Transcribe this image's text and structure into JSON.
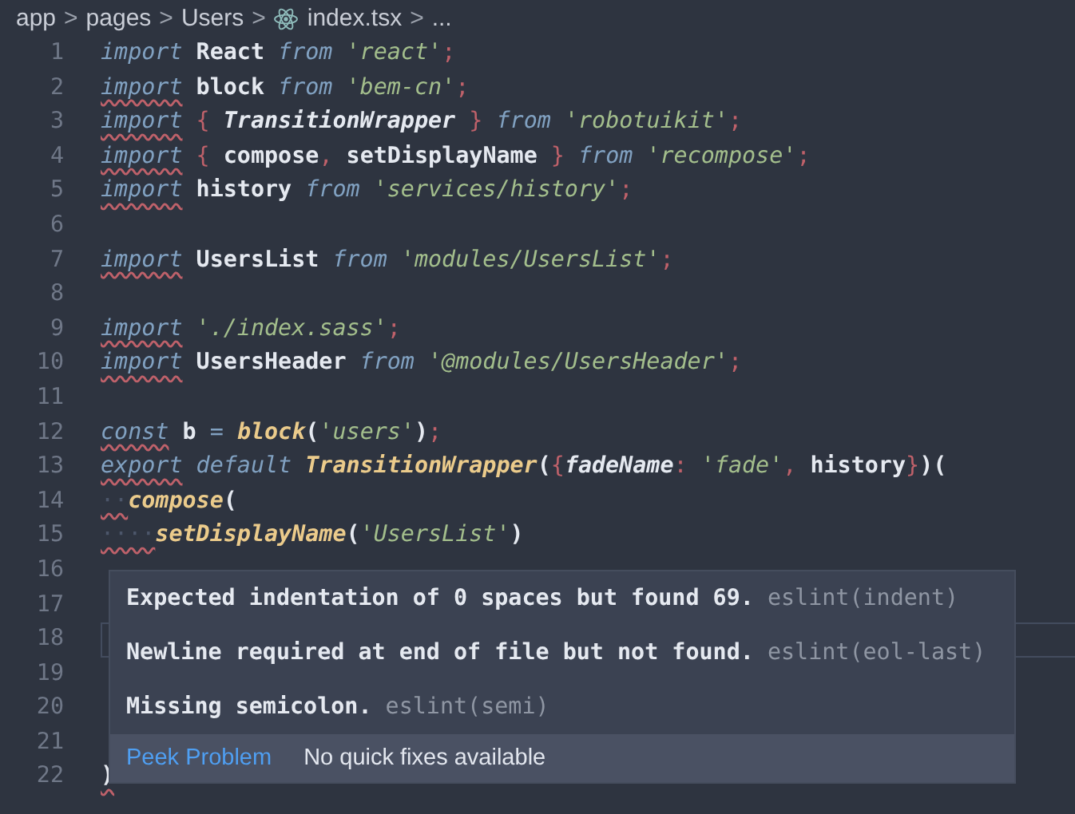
{
  "breadcrumb": {
    "items": [
      "app",
      "pages",
      "Users",
      "index.tsx",
      "..."
    ],
    "separator": ">"
  },
  "lines": [
    {
      "number": "1",
      "current": false,
      "tokens": [
        {
          "text": "import",
          "kind": "kw",
          "error": false
        },
        {
          "text": " React ",
          "kind": "id",
          "error": false
        },
        {
          "text": "from ",
          "kind": "kw",
          "error": false
        },
        {
          "text": "'react'",
          "kind": "str",
          "error": false
        },
        {
          "text": ";",
          "kind": "punct",
          "error": false
        }
      ]
    },
    {
      "number": "2",
      "current": false,
      "tokens": [
        {
          "text": "import",
          "kind": "kw",
          "error": true
        },
        {
          "text": " block ",
          "kind": "id",
          "error": false
        },
        {
          "text": "from ",
          "kind": "kw",
          "error": false
        },
        {
          "text": "'bem-cn'",
          "kind": "str",
          "error": false
        },
        {
          "text": ";",
          "kind": "punct",
          "error": false
        }
      ]
    },
    {
      "number": "3",
      "current": false,
      "tokens": [
        {
          "text": "import",
          "kind": "kw",
          "error": true
        },
        {
          "text": " {",
          "kind": "punct",
          "error": false
        },
        {
          "text": " TransitionWrapper ",
          "kind": "cls",
          "error": false
        },
        {
          "text": "} ",
          "kind": "punct",
          "error": false
        },
        {
          "text": "from ",
          "kind": "kw",
          "error": false
        },
        {
          "text": "'robotuikit'",
          "kind": "str",
          "error": false
        },
        {
          "text": ";",
          "kind": "punct",
          "error": false
        }
      ]
    },
    {
      "number": "4",
      "current": false,
      "tokens": [
        {
          "text": "import",
          "kind": "kw",
          "error": true
        },
        {
          "text": " {",
          "kind": "punct",
          "error": false
        },
        {
          "text": " compose",
          "kind": "id",
          "error": false
        },
        {
          "text": ",",
          "kind": "punct",
          "error": false
        },
        {
          "text": " setDisplayName ",
          "kind": "id",
          "error": false
        },
        {
          "text": "} ",
          "kind": "punct",
          "error": false
        },
        {
          "text": "from ",
          "kind": "kw",
          "error": false
        },
        {
          "text": "'recompose'",
          "kind": "str",
          "error": false
        },
        {
          "text": ";",
          "kind": "punct",
          "error": false
        }
      ]
    },
    {
      "number": "5",
      "current": false,
      "tokens": [
        {
          "text": "import",
          "kind": "kw",
          "error": true
        },
        {
          "text": " history ",
          "kind": "id",
          "error": false
        },
        {
          "text": "from ",
          "kind": "kw",
          "error": false
        },
        {
          "text": "'services/history'",
          "kind": "str",
          "error": false
        },
        {
          "text": ";",
          "kind": "punct",
          "error": false
        }
      ]
    },
    {
      "number": "6",
      "current": false
    },
    {
      "number": "7",
      "current": false,
      "tokens": [
        {
          "text": "import",
          "kind": "kw",
          "error": true
        },
        {
          "text": " UsersList ",
          "kind": "id",
          "error": false
        },
        {
          "text": "from ",
          "kind": "kw",
          "error": false
        },
        {
          "text": "'modules/UsersList'",
          "kind": "str",
          "error": false
        },
        {
          "text": ";",
          "kind": "punct",
          "error": false
        }
      ]
    },
    {
      "number": "8",
      "current": false
    },
    {
      "number": "9",
      "current": false,
      "tokens": [
        {
          "text": "import",
          "kind": "kw",
          "error": true
        },
        {
          "text": " './index.sass'",
          "kind": "str",
          "error": false
        },
        {
          "text": ";",
          "kind": "punct",
          "error": false
        }
      ]
    },
    {
      "number": "10",
      "current": false,
      "tokens": [
        {
          "text": "import",
          "kind": "kw",
          "error": true
        },
        {
          "text": " UsersHeader ",
          "kind": "id",
          "error": false
        },
        {
          "text": "from ",
          "kind": "kw",
          "error": false
        },
        {
          "text": "'@modules/UsersHeader'",
          "kind": "str",
          "error": false
        },
        {
          "text": ";",
          "kind": "punct",
          "error": false
        }
      ]
    },
    {
      "number": "11",
      "current": false
    },
    {
      "number": "12",
      "current": false,
      "tokens": [
        {
          "text": "const",
          "kind": "kw",
          "error": true
        },
        {
          "text": " b ",
          "kind": "id",
          "error": false
        },
        {
          "text": "= ",
          "kind": "op",
          "error": false
        },
        {
          "text": "block",
          "kind": "fn",
          "error": false
        },
        {
          "text": "(",
          "kind": "id",
          "error": false
        },
        {
          "text": "'users'",
          "kind": "str",
          "error": false
        },
        {
          "text": ")",
          "kind": "id",
          "error": false
        },
        {
          "text": ";",
          "kind": "punct",
          "error": false
        }
      ]
    },
    {
      "number": "13",
      "current": false,
      "tokens": [
        {
          "text": "export",
          "kind": "kw",
          "error": true
        },
        {
          "text": " default ",
          "kind": "kw",
          "error": false
        },
        {
          "text": "TransitionWrapper",
          "kind": "fn",
          "error": false
        },
        {
          "text": "(",
          "kind": "id",
          "error": false
        },
        {
          "text": "{",
          "kind": "punct",
          "error": false
        },
        {
          "text": "fadeName",
          "kind": "prop",
          "error": false
        },
        {
          "text": ": ",
          "kind": "punct",
          "error": false
        },
        {
          "text": "'fade'",
          "kind": "str",
          "error": false
        },
        {
          "text": ",",
          "kind": "punct",
          "error": false
        },
        {
          "text": " history",
          "kind": "id",
          "error": false
        },
        {
          "text": "}",
          "kind": "punct",
          "error": false
        },
        {
          "text": ")(",
          "kind": "id",
          "error": false
        }
      ]
    },
    {
      "number": "14",
      "current": false,
      "tokens": [
        {
          "text": "··",
          "kind": "ws",
          "error": true
        },
        {
          "text": "compose",
          "kind": "fn",
          "error": false
        },
        {
          "text": "(",
          "kind": "id",
          "error": false
        }
      ]
    },
    {
      "number": "15",
      "current": false,
      "tokens": [
        {
          "text": "····",
          "kind": "ws",
          "error": true
        },
        {
          "text": "setDisplayName",
          "kind": "fn",
          "error": false
        },
        {
          "text": "(",
          "kind": "id",
          "error": false
        },
        {
          "text": "'UsersList'",
          "kind": "str",
          "error": false
        },
        {
          "text": ")",
          "kind": "id",
          "error": false
        }
      ]
    },
    {
      "number": "16",
      "current": false
    },
    {
      "number": "17",
      "current": false
    },
    {
      "number": "18",
      "current": true
    },
    {
      "number": "19",
      "current": false
    },
    {
      "number": "20",
      "current": false
    },
    {
      "number": "21",
      "current": false
    },
    {
      "number": "22",
      "current": false,
      "tokens": [
        {
          "text": ")",
          "kind": "id",
          "error": true
        }
      ]
    }
  ],
  "hover": {
    "problems": [
      {
        "message": "Expected indentation of 0 spaces but found 69.",
        "source": "eslint(indent)"
      },
      {
        "message": "Newline required at end of file but not found.",
        "source": "eslint(eol-last)"
      },
      {
        "message": "Missing semicolon.",
        "source": "eslint(semi)"
      }
    ],
    "action": "Peek Problem",
    "note": "No quick fixes available"
  }
}
